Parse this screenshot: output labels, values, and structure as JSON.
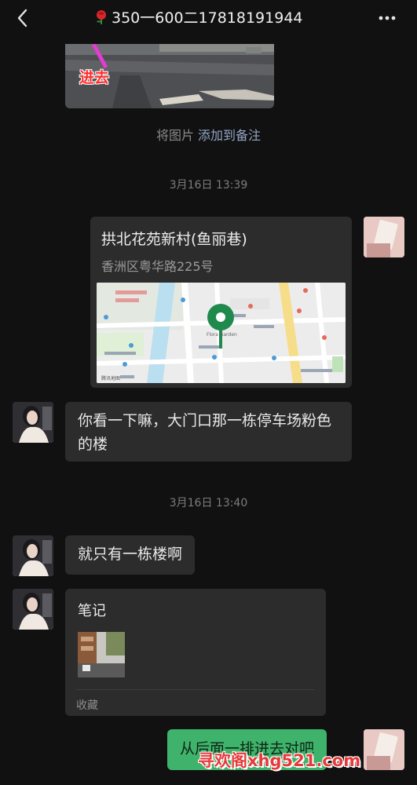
{
  "header": {
    "title": "350一600二17818191944",
    "back_icon": "chevron-left-icon",
    "rose_icon": "rose-icon",
    "more_icon": "more-dots-icon"
  },
  "messages": {
    "image_label": "进去",
    "hint_prefix": "将图片",
    "hint_link": "添加到备注",
    "timestamp_1": "3月16日 13:39",
    "location": {
      "title": "拱北花苑新村(鱼丽巷)",
      "address": "香洲区粤华路225号",
      "map_credit": "腾讯地图",
      "pin_label": "Flora Garden"
    },
    "msg_1": "你看一下嘛，大门口那一栋停车场粉色的楼",
    "timestamp_2": "3月16日 13:40",
    "msg_2": "就只有一栋楼啊",
    "note": {
      "title": "笔记",
      "footer": "收藏"
    },
    "msg_3": "从后面一排进去对吧"
  },
  "watermark": "寻欢阁xhg521.com",
  "colors": {
    "background": "#111111",
    "bubble": "#2c2c2c",
    "green_bubble": "#3fb36b",
    "link": "#93a5c4",
    "map_pin": "#1f8a4c"
  }
}
